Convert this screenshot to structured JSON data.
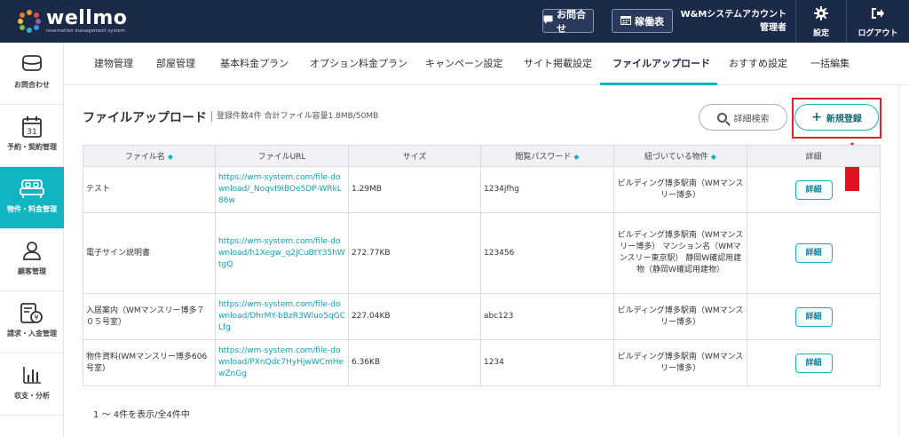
{
  "brand": {
    "name": "wellmo",
    "tagline": "reservation management system",
    "dot_colors": [
      "#f29a2e",
      "#e94b3c",
      "#2fb4c4",
      "#7ac143",
      "#f2c230",
      "#9b59b6",
      "#3498db",
      "#e67e22"
    ]
  },
  "header": {
    "inquiry_label": "お問合せ",
    "schedule_label": "稼働表",
    "account_name": "W&Mシステムアカウント",
    "account_role": "管理者",
    "settings_label": "設定",
    "logout_label": "ログアウト"
  },
  "sidebar": {
    "items": [
      {
        "label": "お問合わせ",
        "icon": "envelope-icon",
        "active": false
      },
      {
        "label": "予約・契約管理",
        "icon": "calendar-icon",
        "active": false,
        "calendar_day": "31"
      },
      {
        "label": "物件・料金管理",
        "icon": "bed-icon",
        "active": true
      },
      {
        "label": "顧客管理",
        "icon": "user-icon",
        "active": false
      },
      {
        "label": "請求・入金管理",
        "icon": "invoice-icon",
        "active": false
      },
      {
        "label": "収支・分析",
        "icon": "bar-chart-icon",
        "active": false
      }
    ]
  },
  "tabs": [
    {
      "label": "建物管理"
    },
    {
      "label": "部屋管理"
    },
    {
      "label": "基本料金プラン"
    },
    {
      "label": "オプション料金プラン"
    },
    {
      "label": "キャンペーン設定"
    },
    {
      "label": "サイト掲載設定"
    },
    {
      "label": "ファイルアップロード",
      "active": true
    },
    {
      "label": "おすすめ設定"
    },
    {
      "label": "一括編集"
    }
  ],
  "page": {
    "title": "ファイルアップロード",
    "meta": "登録件数4件  合計ファイル容量1.8MB/50MB",
    "search_label": "詳細検索",
    "new_label": "新規登録",
    "pager": "1 〜 4件を表示/全4件中"
  },
  "table": {
    "headers": {
      "name": "ファイル名",
      "url": "ファイルURL",
      "size": "サイズ",
      "password": "閲覧パスワード",
      "property": "紐づいている物件",
      "detail": "詳細"
    },
    "detail_button": "詳細",
    "rows": [
      {
        "name": "テスト",
        "url": "https://wm-system.com/file-download/_NoqvI9iBOe5DP-WRkL86w",
        "size": "1.29MB",
        "password": "1234jfhg",
        "property": "ビルディング博多駅南（WMマンスリー博多）"
      },
      {
        "name": "電子サイン説明書",
        "url": "https://wm-system.com/file-download/h1Xegw_q2jCuBtY35hWtgQ",
        "size": "272.77KB",
        "password": "123456",
        "property": "ビルディング博多駅南（WMマンスリー博多） マンション名（WMマンスリー東京駅） 静岡W確認用建物（静岡W確認用建物）"
      },
      {
        "name": "入居案内（WMマンスリー博多７０５号室）",
        "url": "https://wm-system.com/file-download/DhrMY-bBzR3Wluo5qGCLfg",
        "size": "227.04KB",
        "password": "abc123",
        "property": "ビルディング博多駅南（WMマンスリー博多）"
      },
      {
        "name": "物件資料(WMマンスリー博多606号室)",
        "url": "https://wm-system.com/file-download/PXnQdc7HyHjwWCmHewZnGg",
        "size": "6.36KB",
        "password": "1234",
        "property": "ビルディング博多駅南（WMマンスリー博多）"
      }
    ]
  }
}
